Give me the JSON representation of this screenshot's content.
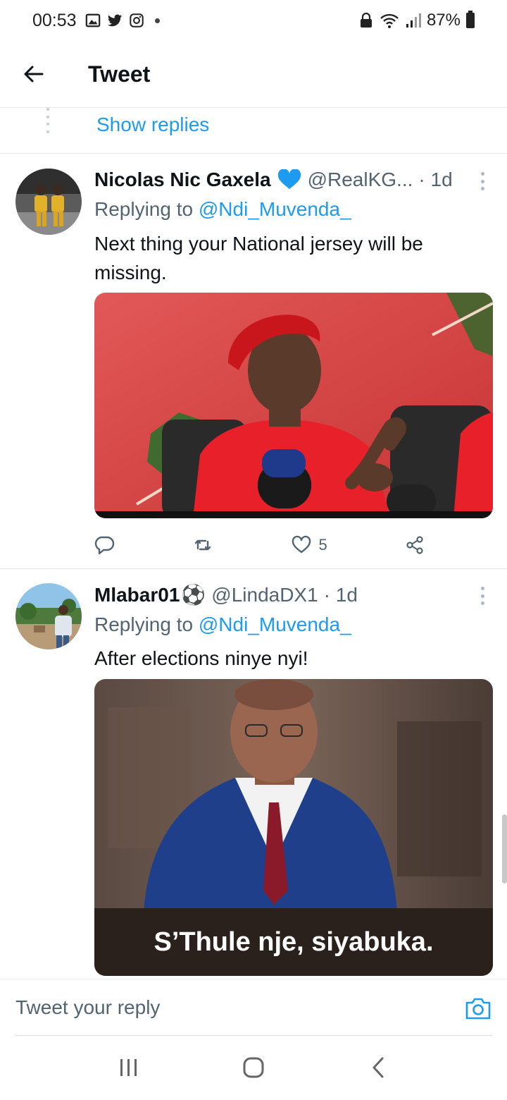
{
  "status_bar": {
    "time": "00:53",
    "battery": "87%",
    "icons": [
      "gallery-icon",
      "twitter-icon",
      "instagram-icon",
      "notification-dot",
      "lock-icon",
      "wifi-icon",
      "signal-icon",
      "battery-icon"
    ]
  },
  "header": {
    "title": "Tweet"
  },
  "thread": {
    "show_replies": "Show replies"
  },
  "tweets": [
    {
      "display_name": "Nicolas Nic Gaxela",
      "verified": true,
      "handle": "@RealKG...",
      "time": "· 1d",
      "replying_prefix": "Replying to",
      "replying_to": "@Ndi_Muvenda_",
      "text": "Next thing your National jersey will be missing.",
      "media_caption": "",
      "reply_count": "",
      "retweet_count": "",
      "like_count": "5"
    },
    {
      "display_name": "Mlabar01",
      "emoji": "⚽",
      "handle": "@LindaDX1",
      "time": "· 1d",
      "replying_prefix": "Replying to",
      "replying_to": "@Ndi_Muvenda_",
      "text": "After elections ninye nyi!",
      "media_caption": "S’Thule nje, siyabuka."
    }
  ],
  "reply_bar": {
    "placeholder": "Tweet your reply"
  },
  "colors": {
    "accent": "#1d9bf0",
    "text": "#0f1419",
    "muted": "#536471"
  }
}
